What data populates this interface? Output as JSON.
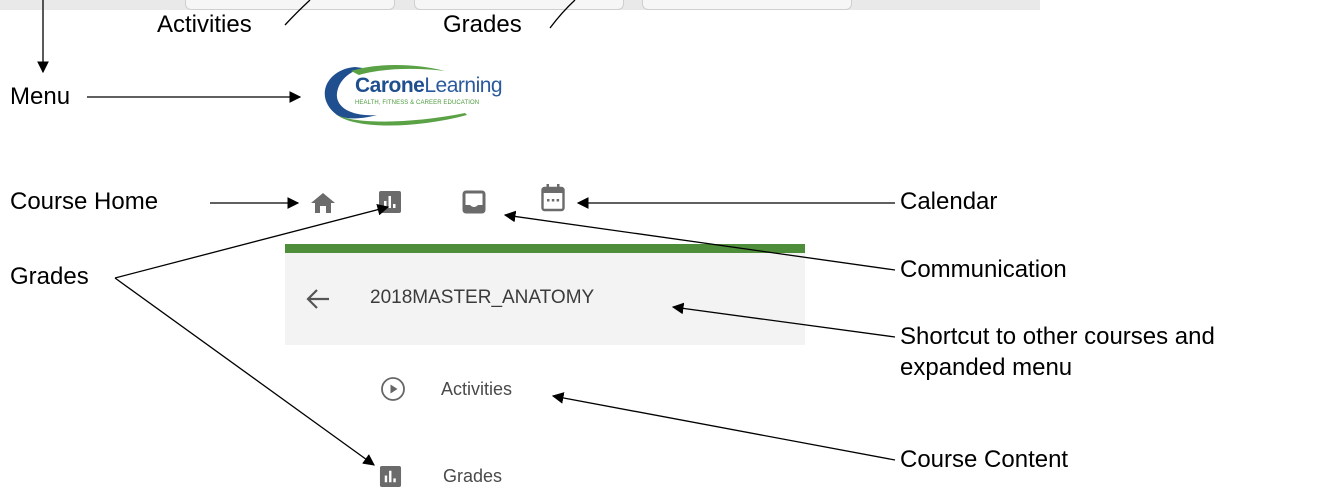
{
  "labels": {
    "activities_top": "Activities",
    "grades_top": "Grades",
    "menu": "Menu",
    "course_home": "Course Home",
    "calendar": "Calendar",
    "grades_left": "Grades",
    "communication": "Communication",
    "shortcut_line1": "Shortcut to other courses and",
    "shortcut_line2": "expanded menu",
    "course_content": "Course Content"
  },
  "logo": {
    "name_bold": "Carone",
    "name_regular": "Learning",
    "tagline": "HEALTH, FITNESS & CAREER EDUCATION"
  },
  "icons": [
    "home-icon",
    "grades-icon",
    "inbox-icon",
    "calendar-icon"
  ],
  "course": {
    "title": "2018MASTER_ANATOMY",
    "accent_color": "#4e8d39"
  },
  "nav": [
    {
      "label": "Activities",
      "icon": "play-circle-icon"
    },
    {
      "label": "Grades",
      "icon": "grades-icon"
    }
  ]
}
